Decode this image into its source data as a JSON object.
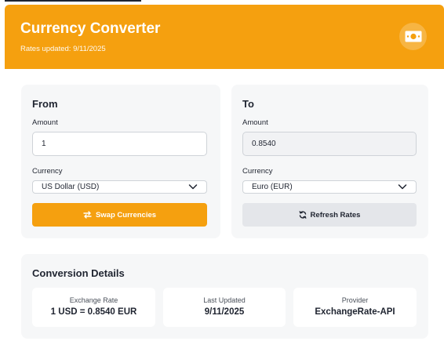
{
  "header": {
    "title": "Currency Converter",
    "rates_updated": "Rates updated: 9/11/2025",
    "icon": "money-icon",
    "accent_color": "#f5a00f"
  },
  "from": {
    "title": "From",
    "amount_label": "Amount",
    "amount_value": "1",
    "currency_label": "Currency",
    "currency_selected": "US Dollar (USD)",
    "swap_button": "Swap Currencies"
  },
  "to": {
    "title": "To",
    "amount_label": "Amount",
    "amount_value": "0.8540",
    "currency_label": "Currency",
    "currency_selected": "Euro (EUR)",
    "refresh_button": "Refresh Rates"
  },
  "details": {
    "title": "Conversion Details",
    "items": [
      {
        "label": "Exchange Rate",
        "value": "1 USD = 0.8540 EUR"
      },
      {
        "label": "Last Updated",
        "value": "9/11/2025"
      },
      {
        "label": "Provider",
        "value": "ExchangeRate-API"
      }
    ]
  }
}
